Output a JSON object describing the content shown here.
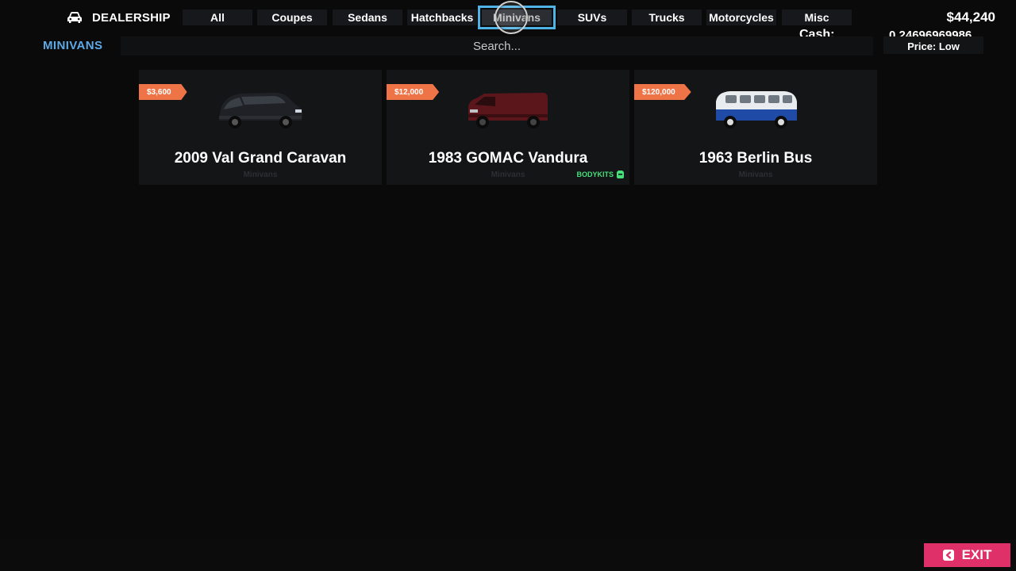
{
  "header": {
    "title": "DEALERSHIP",
    "money": "$44,240",
    "cash_label": "Cash:",
    "cash_value": "0.24696969986",
    "sort_label": "Price: Low"
  },
  "tabs": [
    {
      "label": "All"
    },
    {
      "label": "Coupes"
    },
    {
      "label": "Sedans"
    },
    {
      "label": "Hatchbacks"
    },
    {
      "label": "Minivans",
      "active": true
    },
    {
      "label": "SUVs"
    },
    {
      "label": "Trucks"
    },
    {
      "label": "Motorcycles"
    },
    {
      "label": "Misc"
    }
  ],
  "section": {
    "title": "MINIVANS",
    "search_placeholder": "Search..."
  },
  "vehicles": [
    {
      "price": "$3,600",
      "name": "2009 Val Grand Caravan",
      "category": "Minivans",
      "color": "#1f2126"
    },
    {
      "price": "$12,000",
      "name": "1983 GOMAC Vandura",
      "category": "Minivans",
      "badge": "BODYKITS",
      "color": "#5a161b"
    },
    {
      "price": "$120,000",
      "name": "1963 Berlin Bus",
      "category": "Minivans",
      "color": "#1f4aa6"
    }
  ],
  "footer": {
    "exit_label": "EXIT"
  },
  "colors": {
    "accent_blue": "#4fb3e6",
    "price_tag": "#ee7447",
    "exit": "#e0306a",
    "bodykits": "#46e07b"
  }
}
